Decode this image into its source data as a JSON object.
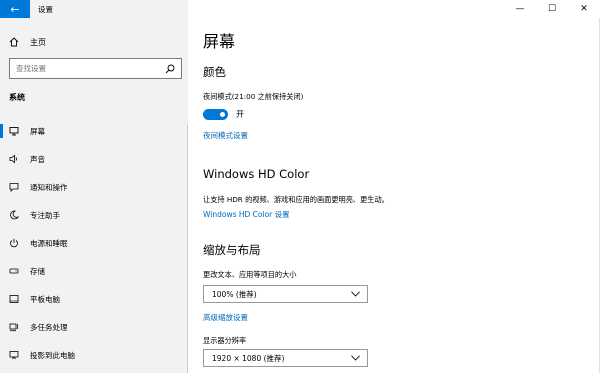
{
  "app": {
    "title": "设置",
    "back_icon": "back-arrow-icon"
  },
  "window": {
    "minimize": "—",
    "maximize": "☐",
    "close": "✕"
  },
  "sidebar": {
    "home_label": "主页",
    "search_placeholder": "查找设置",
    "section_label": "系统",
    "items": [
      {
        "label": "屏幕",
        "icon": "monitor-icon",
        "active": true
      },
      {
        "label": "声音",
        "icon": "speaker-icon",
        "active": false
      },
      {
        "label": "通知和操作",
        "icon": "notification-icon",
        "active": false
      },
      {
        "label": "专注助手",
        "icon": "moon-icon",
        "active": false
      },
      {
        "label": "电源和睡眠",
        "icon": "power-icon",
        "active": false
      },
      {
        "label": "存储",
        "icon": "storage-icon",
        "active": false
      },
      {
        "label": "平板电脑",
        "icon": "tablet-icon",
        "active": false
      },
      {
        "label": "多任务处理",
        "icon": "multitask-icon",
        "active": false
      },
      {
        "label": "投影到此电脑",
        "icon": "project-icon",
        "active": false
      }
    ]
  },
  "main": {
    "title": "屏幕",
    "color_heading": "颜色",
    "night_light_label": "夜间模式(21:00 之前保持关闭)",
    "night_light_state": "开",
    "night_light_settings_link": "夜间模式设置",
    "hdr_heading": "Windows HD Color",
    "hdr_desc": "让支持 HDR 的视频、游戏和应用的画面更明亮、更生动。",
    "hdr_link": "Windows HD Color 设置",
    "scale_heading": "缩放与布局",
    "scale_label": "更改文本、应用等项目的大小",
    "scale_value": "100% (推荐)",
    "advanced_scale_link": "高级缩放设置",
    "resolution_label": "显示器分辨率",
    "resolution_value": "1920 × 1080 (推荐)"
  },
  "colors": {
    "accent": "#0078d7",
    "link": "#0067b8",
    "sidebar_bg": "#f2f2f2"
  }
}
